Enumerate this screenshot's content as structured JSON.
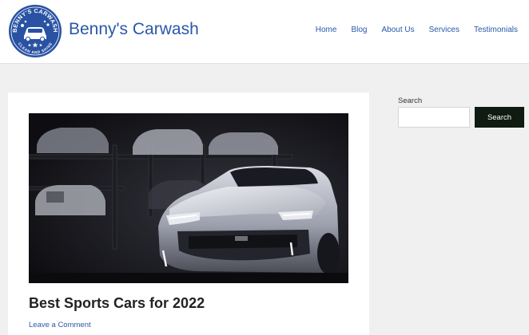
{
  "header": {
    "logo_text_top": "BENNY'S CARWASH",
    "logo_text_bottom": "CLEAN AND SHINE",
    "site_title": "Benny's Carwash",
    "nav": [
      "Home",
      "Blog",
      "About Us",
      "Services",
      "Testimonials"
    ]
  },
  "post": {
    "title": "Best Sports Cars for 2022",
    "comment_link": "Leave a Comment"
  },
  "sidebar": {
    "search_label": "Search",
    "search_value": "",
    "search_button": "Search"
  },
  "colors": {
    "link": "#2a58a8",
    "logo": "#2952a3",
    "button": "#0f1a10",
    "background": "#f0f0f0"
  }
}
